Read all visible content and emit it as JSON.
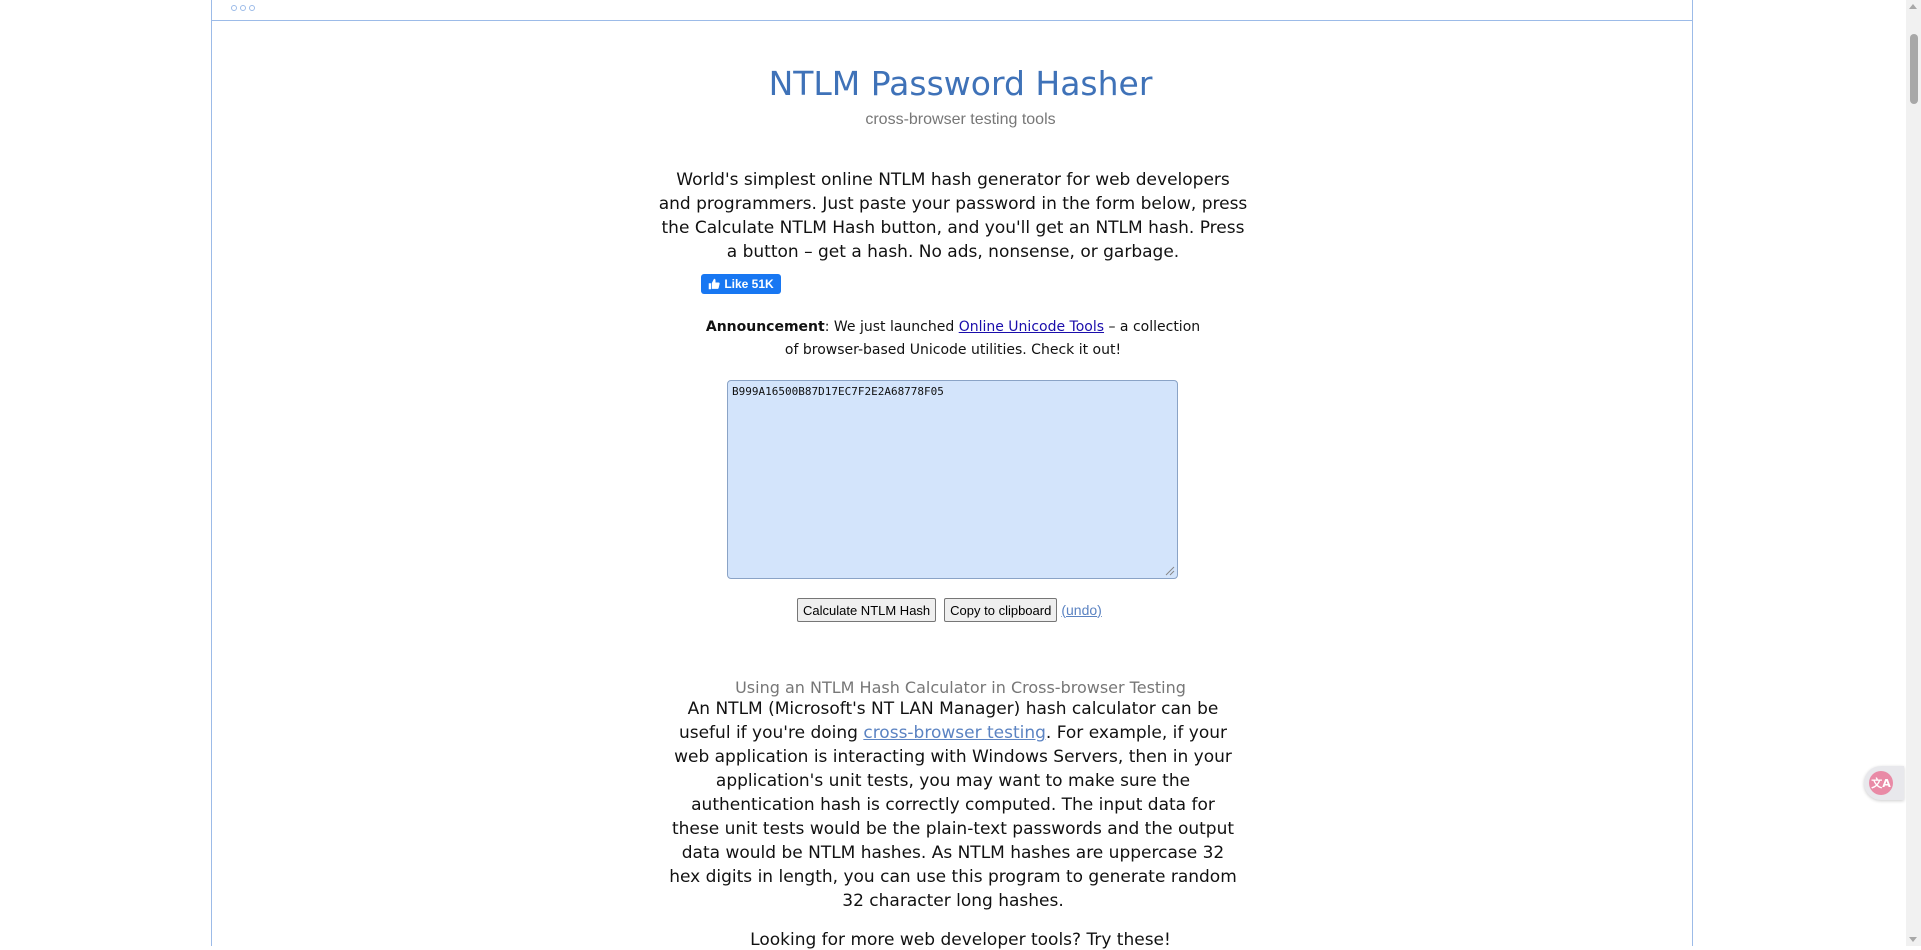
{
  "page": {
    "title": "NTLM Password Hasher",
    "subtitle": "cross-browser testing tools",
    "intro": "World's simplest online NTLM hash generator for web developers and programmers. Just paste your password in the form below, press the Calculate NTLM Hash button, and you'll get an NTLM hash. Press a button – get a hash. No ads, nonsense, or garbage.",
    "like_button": "Like 51K",
    "announcement": {
      "label": "Announcement",
      "text_before": ": We just launched ",
      "link": "Online Unicode Tools",
      "text_after": " – a collection of browser-based Unicode utilities. Check it out!"
    },
    "textarea_value": "B999A16500B87D17EC7F2E2A68778F05",
    "buttons": {
      "calculate": "Calculate NTLM Hash",
      "copy": "Copy to clipboard",
      "undo": "undo"
    },
    "section": {
      "heading": "Using an NTLM Hash Calculator in Cross-browser Testing",
      "text_before": "An NTLM (Microsoft's NT LAN Manager) hash calculator can be useful if you're doing ",
      "link": "cross-browser testing",
      "text_after": ". For example, if your web application is interacting with Windows Servers, then in your application's unit tests, you may want to make sure the authentication hash is correctly computed. The input data for these unit tests would be the plain-text passwords and the output data would be NTLM hashes. As NTLM hashes are uppercase 32 hex digits in length, you can use this program to generate random 32 character long hashes."
    },
    "more_tools": "Looking for more web developer tools? Try these!"
  },
  "colors": {
    "title": "#3f72b8",
    "frame_border": "#9cbbe8",
    "textarea_bg": "#d3e4fb",
    "link": "#1a0dab",
    "like_bg": "#1877f2"
  },
  "icons": [
    "thumbs-up-icon",
    "translate-icon"
  ]
}
